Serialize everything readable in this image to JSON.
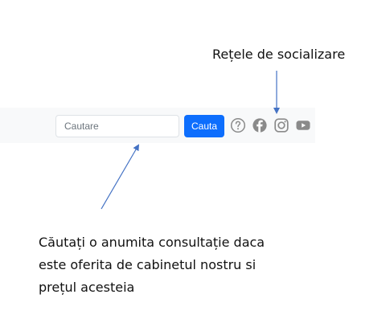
{
  "search": {
    "placeholder": "Cautare",
    "button_label": "Cauta"
  },
  "toolbar_icons": [
    "help-circle-icon",
    "facebook-icon",
    "instagram-icon",
    "youtube-icon"
  ],
  "annotations": {
    "social_label": "Rețele de socializare",
    "search_description": [
      "Căutați o anumita consultație daca",
      "este oferita de cabinetul nostru si",
      "prețul acesteia"
    ]
  },
  "colors": {
    "primary_button": "#0d6efd",
    "toolbar_background": "#f8f9fa",
    "icon_color": "#8a8a8a",
    "arrow_color": "#4472c4"
  }
}
